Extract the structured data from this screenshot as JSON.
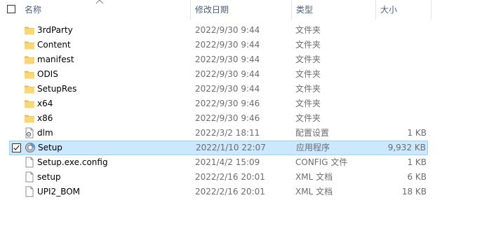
{
  "columns": {
    "name": "名称",
    "modified": "修改日期",
    "type": "类型",
    "size": "大小"
  },
  "files": [
    {
      "name": "3rdParty",
      "modified": "2022/9/30 9:44",
      "type": "文件夹",
      "size": "",
      "icon": "folder-icon",
      "selected": false
    },
    {
      "name": "Content",
      "modified": "2022/9/30 9:44",
      "type": "文件夹",
      "size": "",
      "icon": "folder-icon",
      "selected": false
    },
    {
      "name": "manifest",
      "modified": "2022/9/30 9:44",
      "type": "文件夹",
      "size": "",
      "icon": "folder-icon",
      "selected": false
    },
    {
      "name": "ODIS",
      "modified": "2022/9/30 9:44",
      "type": "文件夹",
      "size": "",
      "icon": "folder-icon",
      "selected": false
    },
    {
      "name": "SetupRes",
      "modified": "2022/9/30 9:44",
      "type": "文件夹",
      "size": "",
      "icon": "folder-icon",
      "selected": false
    },
    {
      "name": "x64",
      "modified": "2022/9/30 9:46",
      "type": "文件夹",
      "size": "",
      "icon": "folder-icon",
      "selected": false
    },
    {
      "name": "x86",
      "modified": "2022/9/30 9:46",
      "type": "文件夹",
      "size": "",
      "icon": "folder-icon",
      "selected": false
    },
    {
      "name": "dlm",
      "modified": "2022/3/2 18:11",
      "type": "配置设置",
      "size": "1 KB",
      "icon": "config-file-icon",
      "selected": false
    },
    {
      "name": "Setup",
      "modified": "2022/1/10 22:07",
      "type": "应用程序",
      "size": "9,932 KB",
      "icon": "setup-app-icon",
      "selected": true
    },
    {
      "name": "Setup.exe.config",
      "modified": "2021/4/2 15:09",
      "type": "CONFIG 文件",
      "size": "1 KB",
      "icon": "file-icon",
      "selected": false
    },
    {
      "name": "setup",
      "modified": "2022/2/16 20:01",
      "type": "XML 文档",
      "size": "6 KB",
      "icon": "file-icon",
      "selected": false
    },
    {
      "name": "UPI2_BOM",
      "modified": "2022/2/16 20:01",
      "type": "XML 文档",
      "size": "18 KB",
      "icon": "file-icon",
      "selected": false
    }
  ],
  "colors": {
    "selection_bg": "#cce8ff",
    "selection_border": "#99d1ff",
    "folder": "#f8d775",
    "header_text": "#4c607a"
  }
}
